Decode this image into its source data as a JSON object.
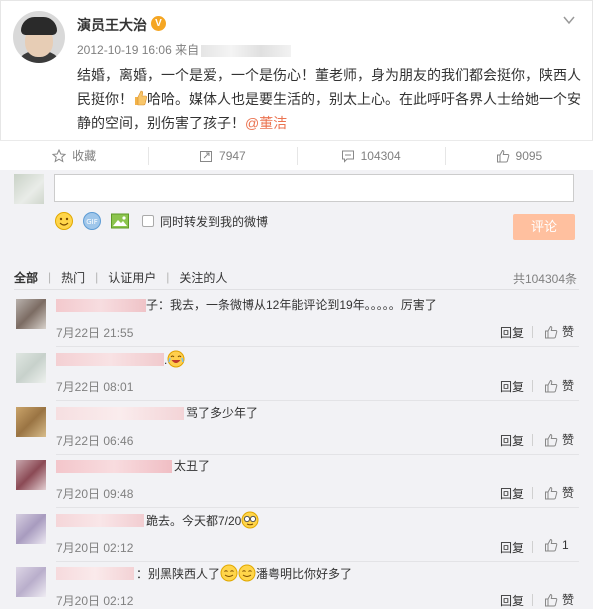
{
  "post": {
    "author": "演员王大治",
    "verified_badge": "V",
    "timestamp": "2012-10-19 16:06",
    "source_prefix": "来自",
    "text_part1": "结婚，离婚，一个是爱，一个是伤心！董老师，身为朋友的我们都会挺你，陕西人民挺你！",
    "text_part2": "哈哈。媒体人也是要生活的，别太上心。在此呼吁各界人士给她一个安静的空间，别伤害了孩子！",
    "mention": "@董洁"
  },
  "actions": {
    "favorite": "收藏",
    "repost_count": "7947",
    "comment_count": "104304",
    "like_count": "9095"
  },
  "composer": {
    "repost_checkbox_label": "同时转发到我的微博",
    "submit_label": "评论"
  },
  "filters": [
    "全部",
    "热门",
    "认证用户",
    "关注的人"
  ],
  "total_label": "共104304条",
  "comments": [
    {
      "text": "子：我去，一条微博从12年能评论到19年。。。。。厉害了",
      "time": "7月22日 21:55",
      "reply": "回复",
      "like": "赞"
    },
    {
      "text": ".",
      "time": "7月22日 08:01",
      "reply": "回复",
      "like": "赞"
    },
    {
      "text": "骂了多少年了",
      "time": "7月22日 06:46",
      "reply": "回复",
      "like": "赞"
    },
    {
      "text": "太丑了",
      "time": "7月20日 09:48",
      "reply": "回复",
      "like": "赞"
    },
    {
      "text": "跪去。今天都7/20",
      "time": "7月20日 02:12",
      "reply": "回复",
      "like": "1"
    },
    {
      "text": "：别黑陕西人了",
      "text_after": "潘粤明比你好多了",
      "time": "7月20日 02:12",
      "reply": "回复",
      "like": "赞"
    }
  ],
  "colors": {
    "accent": "#eb7350",
    "badge": "#f5a623",
    "submit_disabled": "#ffc09f",
    "comment_bg": "#f2f2f5"
  },
  "icons": [
    "chevron-down-icon",
    "star-icon",
    "repost-icon",
    "comment-icon",
    "like-icon",
    "thumbs-up-emoji",
    "smiley-icon",
    "gif-icon",
    "image-icon",
    "laughing-emoji",
    "sunglasses-emoji",
    "grin-emoji"
  ]
}
